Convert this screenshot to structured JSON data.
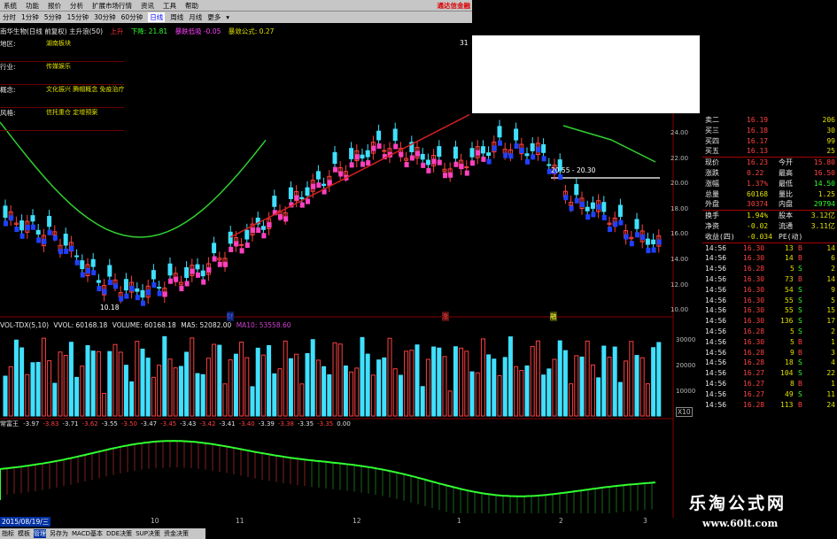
{
  "menu": {
    "items": [
      "系统",
      "功能",
      "报价",
      "分析",
      "扩展市场行情",
      "资讯",
      "工具",
      "帮助"
    ],
    "broker": "通达信金融"
  },
  "periods": {
    "items": [
      "分时",
      "1分钟",
      "5分钟",
      "15分钟",
      "30分钟",
      "60分钟",
      "日线",
      "周线",
      "月线",
      "更多"
    ],
    "selected": "日线"
  },
  "info": {
    "title": "南华生物(日线 前复权) 主升浪(50)",
    "t1": "上升",
    "t2": "下降: 21.81",
    "t3": "暴跌低吸 -0.05",
    "t4": "暴敛公式: 0.27"
  },
  "fundamentals": [
    {
      "label": "地区:",
      "value": "湖南板块"
    },
    {
      "label": "行业:",
      "value": "传媒娱乐"
    },
    {
      "label": "概念:",
      "value": "文化振兴 腾帽概念 免疫治疗"
    },
    {
      "label": "风格:",
      "value": "信托重仓 定增预案"
    }
  ],
  "annotations": {
    "high": "31",
    "low": "10.18",
    "range": "20.55 - 20.30"
  },
  "yaxis_price": [
    "24.00",
    "22.00",
    "20.00",
    "18.00",
    "16.00",
    "14.00",
    "12.00",
    "10.00"
  ],
  "vol": {
    "title": "VOL-TDX(5,10)",
    "vvol": "VVOL: 60168.18",
    "volume": "VOLUME: 60168.18",
    "ma5": "MA5: 52082.00",
    "ma10": "MA10: 53558.60",
    "yaxis": [
      "30000",
      "20000",
      "10000"
    ],
    "unit": "X10"
  },
  "ind": {
    "title": "常富王",
    "values": [
      "-3.97",
      "-3.83",
      "-3.71",
      "-3.62",
      "-3.55",
      "-3.50",
      "-3.47",
      "-3.45",
      "-3.43",
      "-3.42",
      "-3.41",
      "-3.40",
      "-3.39",
      "-3.38",
      "-3.35",
      "-3.35",
      "0.00"
    ]
  },
  "markers": [
    "财",
    "涨",
    "融"
  ],
  "date": "2015/08/19/三",
  "xticks": [
    "10",
    "11",
    "12",
    "1",
    "2",
    "3"
  ],
  "bottom_tabs": [
    "指标",
    "模板",
    "管理",
    "另存为",
    "MACD基本",
    "DDE决策",
    "SUP决策",
    "资金决策"
  ],
  "bottom_selected": "管理",
  "quote": {
    "asks": [
      {
        "label": "卖二",
        "price": "16.19",
        "vol": "206"
      },
      {
        "label": "买三",
        "price": "16.18",
        "vol": "30"
      },
      {
        "label": "买四",
        "price": "16.17",
        "vol": "99"
      },
      {
        "label": "买五",
        "price": "16.13",
        "vol": "25"
      }
    ],
    "stats": [
      {
        "l1": "现价",
        "v1": "16.23",
        "l2": "今开",
        "v2": "15.80"
      },
      {
        "l1": "涨跌",
        "v1": "0.22",
        "l2": "最高",
        "v2": "16.50"
      },
      {
        "l1": "涨幅",
        "v1": "1.37%",
        "l2": "最低",
        "v2": "14.50"
      },
      {
        "l1": "总量",
        "v1": "60168",
        "l2": "量比",
        "v2": "1.25"
      },
      {
        "l1": "外盘",
        "v1": "30374",
        "l2": "内盘",
        "v2": "29794"
      }
    ],
    "stats2": [
      {
        "l1": "换手",
        "v1": "1.94%",
        "l2": "股本",
        "v2": "3.12亿"
      },
      {
        "l1": "净资",
        "v1": "-0.02",
        "l2": "流通",
        "v2": "3.11亿"
      },
      {
        "l1": "收益(四)",
        "v1": "-0.034",
        "l2": "PE(动)",
        "v2": ""
      }
    ],
    "ticks": [
      {
        "t": "14:56",
        "p": "16.30",
        "v": "13",
        "d": "B",
        "n": "14"
      },
      {
        "t": "14:56",
        "p": "16.30",
        "v": "14",
        "d": "B",
        "n": "6"
      },
      {
        "t": "14:56",
        "p": "16.28",
        "v": "5",
        "d": "S",
        "n": "2"
      },
      {
        "t": "14:56",
        "p": "16.30",
        "v": "73",
        "d": "B",
        "n": "14"
      },
      {
        "t": "14:56",
        "p": "16.30",
        "v": "54",
        "d": "S",
        "n": "9"
      },
      {
        "t": "14:56",
        "p": "16.30",
        "v": "55",
        "d": "S",
        "n": "5"
      },
      {
        "t": "14:56",
        "p": "16.30",
        "v": "55",
        "d": "S",
        "n": "15"
      },
      {
        "t": "14:56",
        "p": "16.30",
        "v": "136",
        "d": "S",
        "n": "17"
      },
      {
        "t": "14:56",
        "p": "16.28",
        "v": "5",
        "d": "S",
        "n": "2"
      },
      {
        "t": "14:56",
        "p": "16.30",
        "v": "5",
        "d": "B",
        "n": "1"
      },
      {
        "t": "14:56",
        "p": "16.28",
        "v": "9",
        "d": "B",
        "n": "3"
      },
      {
        "t": "14:56",
        "p": "16.28",
        "v": "18",
        "d": "S",
        "n": "4"
      },
      {
        "t": "14:56",
        "p": "16.27",
        "v": "104",
        "d": "S",
        "n": "22"
      },
      {
        "t": "14:56",
        "p": "16.27",
        "v": "8",
        "d": "B",
        "n": "1"
      },
      {
        "t": "14:56",
        "p": "16.27",
        "v": "49",
        "d": "S",
        "n": "11"
      },
      {
        "t": "14:56",
        "p": "16.28",
        "v": "113",
        "d": "B",
        "n": "24"
      }
    ]
  },
  "watermark": {
    "cn": "乐淘公式网",
    "url": "www.60lt.com"
  }
}
